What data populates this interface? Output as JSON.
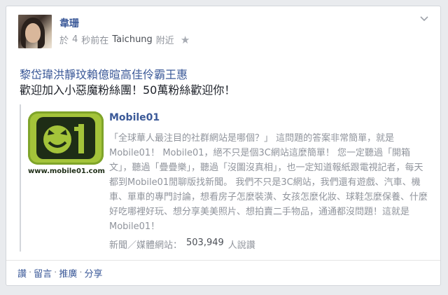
{
  "post": {
    "author": "韋珊",
    "time_prefix": "於",
    "time_number": "4",
    "time_suffix": "秒前在",
    "place": "Taichung",
    "place_suffix": "附近",
    "line1": "黎岱瑋洪靜玟賴億暄高佳伶霸王惠",
    "line2": "歡迎加入小惡魔粉絲團！50萬粉絲歡迎你！"
  },
  "share": {
    "logo_url": "www.mobile01.com",
    "title": "Mobile01",
    "description": "「全球華人最注目的社群網站是哪個？」 這問題的答案非常簡單，就是Mobile01！ Mobile01，絕不只是個3C網站這麼簡單！ 您一定聽過「開箱文」，聽過「疊疊樂」，聽過「沒圖沒真相」，也一定知道報紙跟電視記者，每天都到Mobile01閒聊版找新聞。 我們不只是3C網站，我們還有遊戲、汽車、機車、單車的專門討論，想看房子怎麼裝潢、女孩怎麼化妝、球鞋怎麼保養、什麼好吃哪裡好玩、想分享美美照片、想拍賣二手物品，通通都沒問題！這就是Mobile01！",
    "category": "新聞／媒體網站：",
    "count": "503,949",
    "count_suffix": "人說讚"
  },
  "actions": {
    "like": "讚",
    "comment": "留言",
    "promote": "推廣",
    "share": "分享",
    "separator": "·"
  },
  "icons": {
    "star": "star-icon",
    "chevron": "chevron-down-icon"
  },
  "colors": {
    "link": "#3b5998",
    "meta": "#90949c",
    "logo_green": "#a4c43a"
  }
}
